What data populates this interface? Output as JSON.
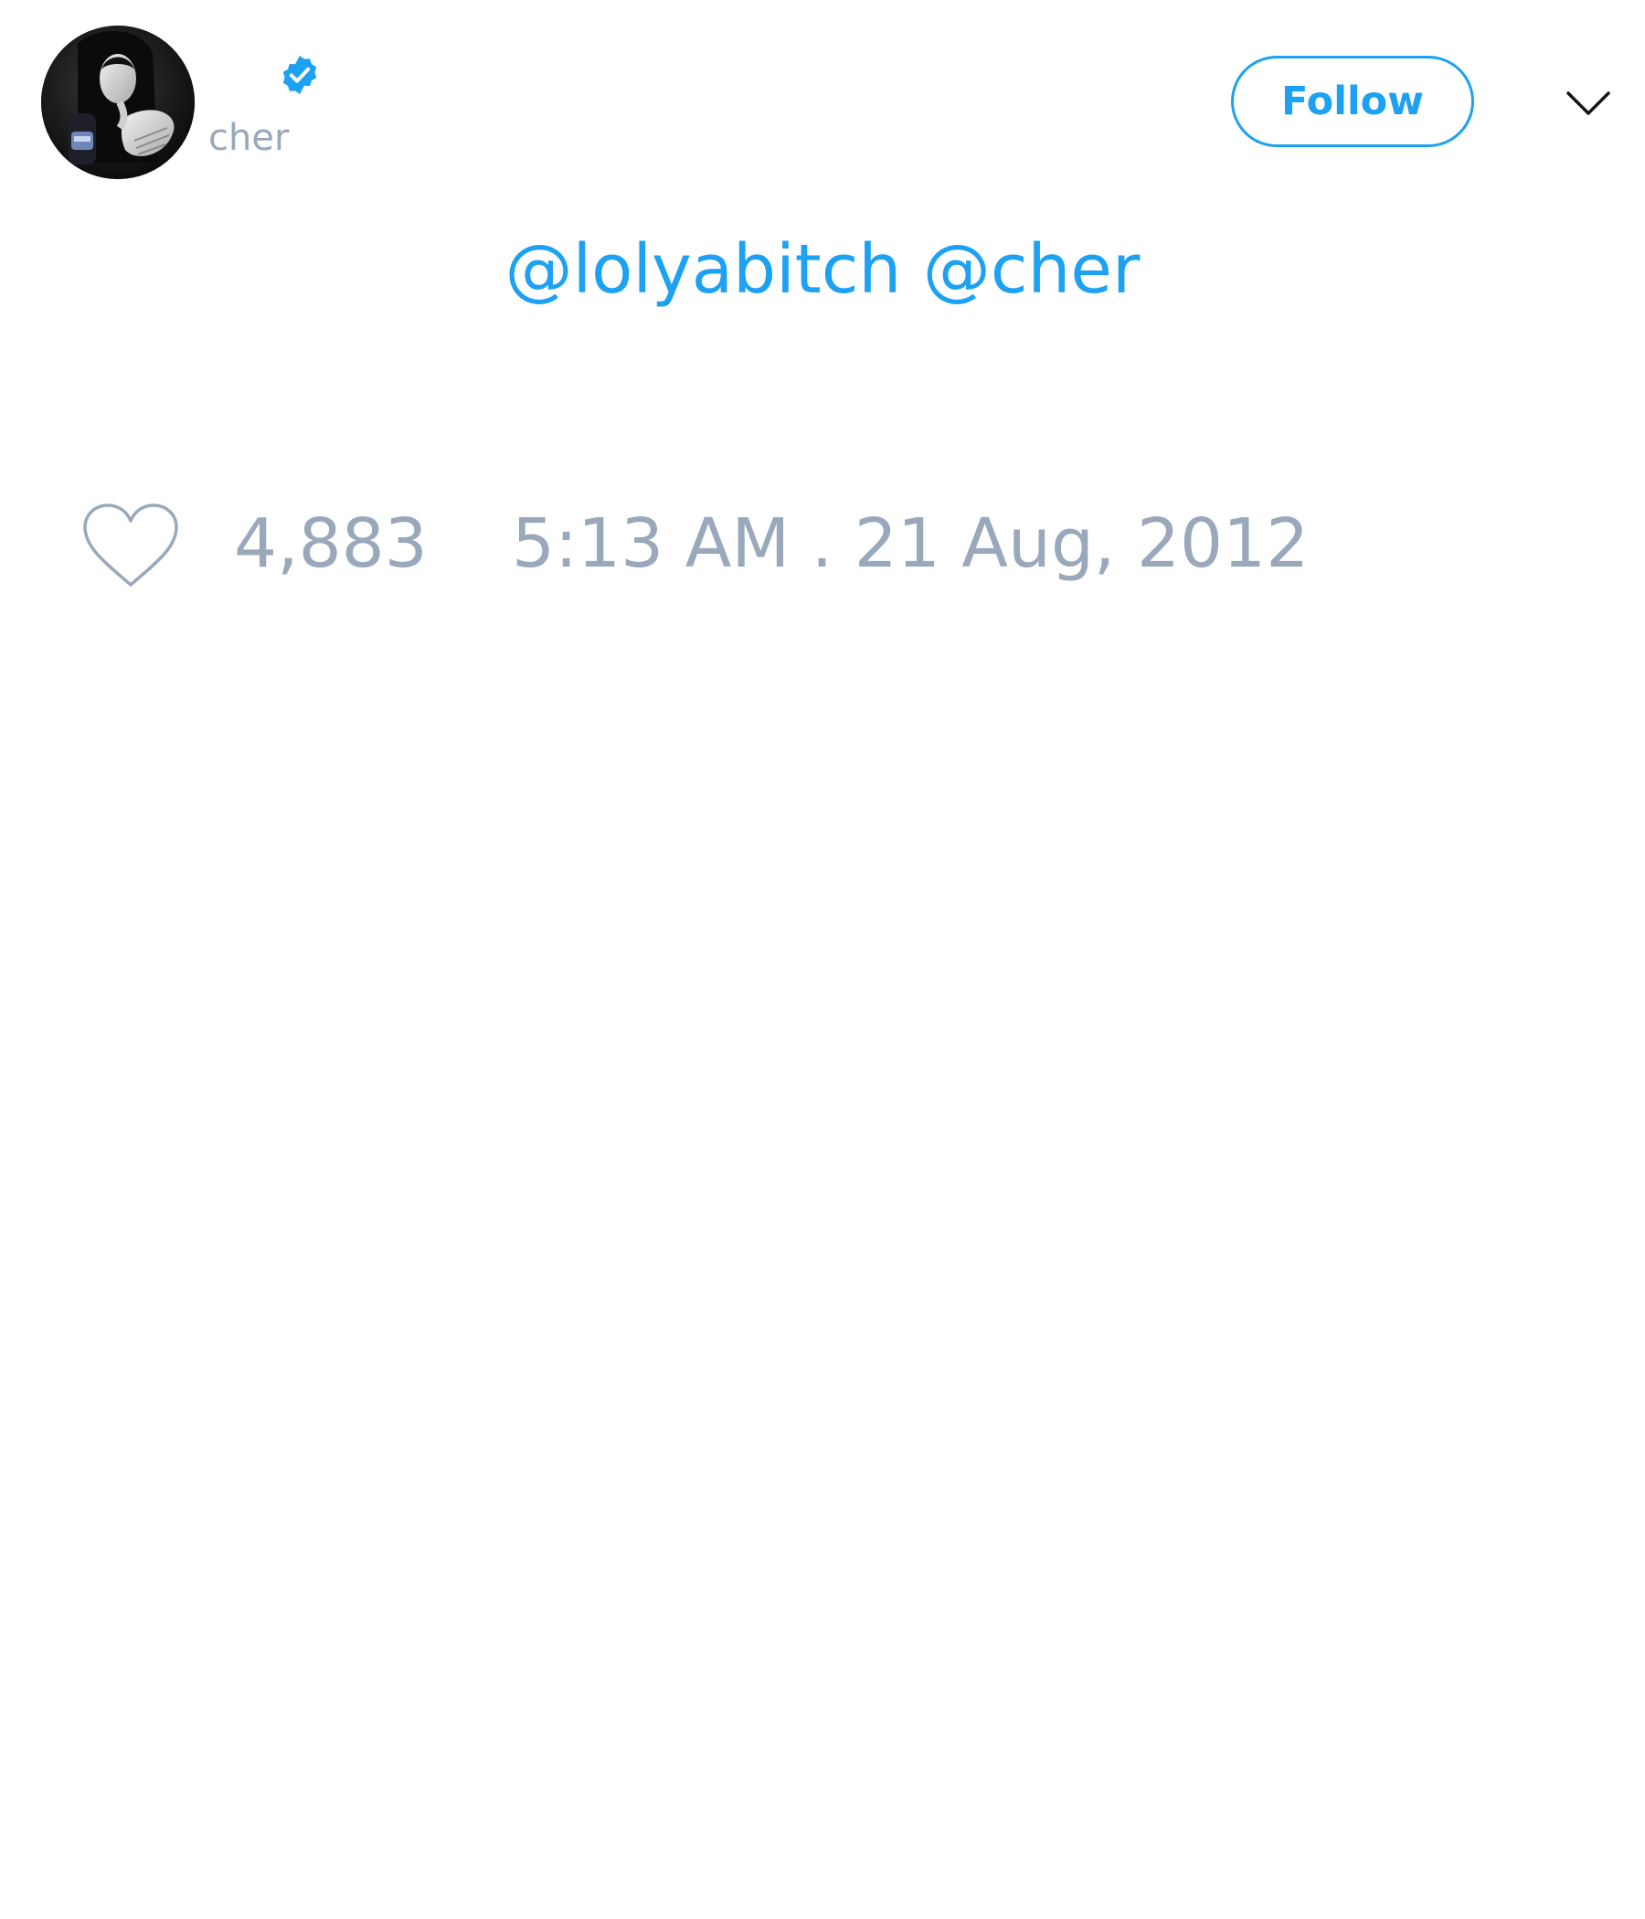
{
  "header": {
    "handle": "cher",
    "follow_label": "Follow",
    "verified": true
  },
  "tweet": {
    "mentions": [
      "@lolyabitch",
      "@cher"
    ]
  },
  "footer": {
    "like_count": "4,883",
    "timestamp": "5:13 AM . 21 Aug, 2012"
  },
  "icons": {
    "verified": "verified-badge-icon",
    "more": "chevron-down-icon",
    "like": "heart-icon"
  },
  "colors": {
    "accent": "#1da1f2",
    "muted": "#99a8bb",
    "text_dark": "#14171a",
    "background": "#ffffff"
  }
}
